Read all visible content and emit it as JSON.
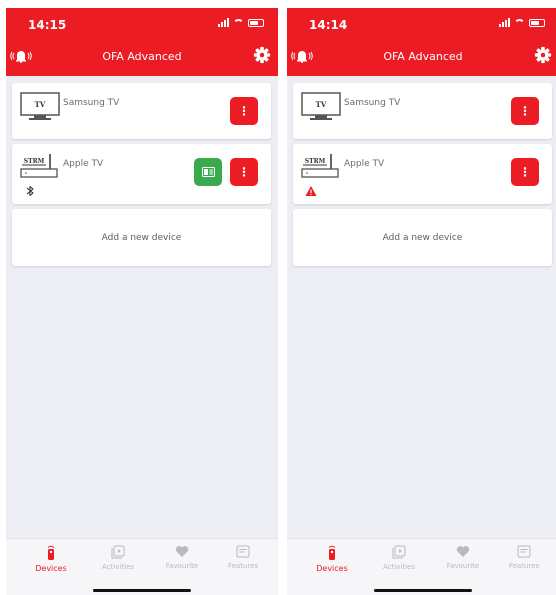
{
  "theme": {
    "accent": "#ec1c24",
    "green": "#3aab4c",
    "background": "#eceef3"
  },
  "screens": [
    {
      "time": "14:15",
      "title": "OFA Advanced",
      "devices": [
        {
          "name": "Samsung TV",
          "icon": "tv-icon",
          "icon_text": "TV",
          "action": "menu-button"
        },
        {
          "name": "Apple TV",
          "icon": "streamer-icon",
          "icon_text": "STRM",
          "action": "menu-button",
          "extra_button": "remote-button",
          "status_icon": "bluetooth-icon"
        }
      ],
      "add_label": "Add a new device",
      "tabs": [
        "Devices",
        "Activities",
        "Favourite",
        "Features"
      ],
      "active_tab": "Devices"
    },
    {
      "time": "14:14",
      "title": "OFA Advanced",
      "devices": [
        {
          "name": "Samsung TV",
          "icon": "tv-icon",
          "icon_text": "TV",
          "action": "menu-button"
        },
        {
          "name": "Apple TV",
          "icon": "streamer-icon",
          "icon_text": "STRM",
          "action": "menu-button",
          "status_icon": "warning-icon"
        }
      ],
      "add_label": "Add a new device",
      "tabs": [
        "Devices",
        "Activities",
        "Favourite",
        "Features"
      ],
      "active_tab": "Devices"
    }
  ]
}
